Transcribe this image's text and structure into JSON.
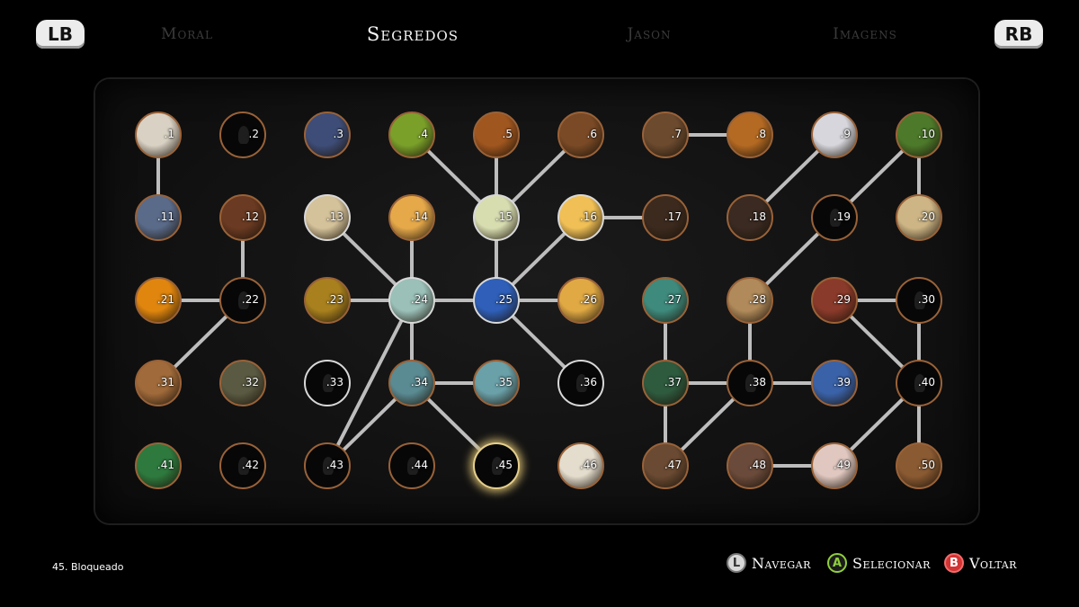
{
  "header": {
    "lb_label": "LB",
    "rb_label": "RB",
    "tabs": [
      {
        "label": "Moral",
        "active": false
      },
      {
        "label": "Segredos",
        "active": true
      },
      {
        "label": "Jason",
        "active": false
      },
      {
        "label": "Imagens",
        "active": false
      }
    ]
  },
  "board": {
    "selected": 45,
    "nodes": [
      {
        "id": 1,
        "label": ".1",
        "state": "photo",
        "color": "#d9d2c4"
      },
      {
        "id": 2,
        "label": ".2",
        "state": "locked"
      },
      {
        "id": 3,
        "label": ".3",
        "state": "photo",
        "color": "#3e4d78"
      },
      {
        "id": 4,
        "label": ".4",
        "state": "photo",
        "color": "#7aa02a"
      },
      {
        "id": 5,
        "label": ".5",
        "state": "photo",
        "color": "#a0561f"
      },
      {
        "id": 6,
        "label": ".6",
        "state": "photo",
        "color": "#7a4a26"
      },
      {
        "id": 7,
        "label": ".7",
        "state": "photo",
        "color": "#6b4a2e"
      },
      {
        "id": 8,
        "label": ".8",
        "state": "photo",
        "color": "#b56a23"
      },
      {
        "id": 9,
        "label": ".9",
        "state": "photo",
        "color": "#d6d6dc"
      },
      {
        "id": 10,
        "label": ".10",
        "state": "photo",
        "color": "#4d7a2a"
      },
      {
        "id": 11,
        "label": ".11",
        "state": "photo",
        "color": "#5a6b8a"
      },
      {
        "id": 12,
        "label": ".12",
        "state": "photo",
        "color": "#6a3a22"
      },
      {
        "id": 13,
        "label": ".13",
        "state": "photo",
        "color": "#d4c29a",
        "ring": "white"
      },
      {
        "id": 14,
        "label": ".14",
        "state": "photo",
        "color": "#e6a94a"
      },
      {
        "id": 15,
        "label": ".15",
        "state": "photo",
        "color": "#d8ddb0",
        "ring": "white"
      },
      {
        "id": 16,
        "label": ".16",
        "state": "photo",
        "color": "#f0c056",
        "ring": "white"
      },
      {
        "id": 17,
        "label": ".17",
        "state": "photo",
        "color": "#3c2a1e"
      },
      {
        "id": 18,
        "label": ".18",
        "state": "photo",
        "color": "#3a2a22"
      },
      {
        "id": 19,
        "label": ".19",
        "state": "locked"
      },
      {
        "id": 20,
        "label": ".20",
        "state": "photo",
        "color": "#cdb585"
      },
      {
        "id": 21,
        "label": ".21",
        "state": "photo",
        "color": "#e0860f"
      },
      {
        "id": 22,
        "label": ".22",
        "state": "locked"
      },
      {
        "id": 23,
        "label": ".23",
        "state": "photo",
        "color": "#a8801e"
      },
      {
        "id": 24,
        "label": ".24",
        "state": "photo",
        "color": "#9ac0b8",
        "ring": "white"
      },
      {
        "id": 25,
        "label": ".25",
        "state": "photo",
        "color": "#2f5fb8",
        "ring": "white"
      },
      {
        "id": 26,
        "label": ".26",
        "state": "photo",
        "color": "#e0a944"
      },
      {
        "id": 27,
        "label": ".27",
        "state": "photo",
        "color": "#3e8a7c"
      },
      {
        "id": 28,
        "label": ".28",
        "state": "photo",
        "color": "#b08a5a"
      },
      {
        "id": 29,
        "label": ".29",
        "state": "photo",
        "color": "#8a3a2a"
      },
      {
        "id": 30,
        "label": ".30",
        "state": "locked"
      },
      {
        "id": 31,
        "label": ".31",
        "state": "photo",
        "color": "#a06a3a"
      },
      {
        "id": 32,
        "label": ".32",
        "state": "photo",
        "color": "#5a5a42"
      },
      {
        "id": 33,
        "label": ".33",
        "state": "locked",
        "ring": "white"
      },
      {
        "id": 34,
        "label": ".34",
        "state": "photo",
        "color": "#5a8a92"
      },
      {
        "id": 35,
        "label": ".35",
        "state": "photo",
        "color": "#6aa0a8"
      },
      {
        "id": 36,
        "label": ".36",
        "state": "locked",
        "ring": "white"
      },
      {
        "id": 37,
        "label": ".37",
        "state": "photo",
        "color": "#2e5a3e"
      },
      {
        "id": 38,
        "label": ".38",
        "state": "locked"
      },
      {
        "id": 39,
        "label": ".39",
        "state": "photo",
        "color": "#3a62a8"
      },
      {
        "id": 40,
        "label": ".40",
        "state": "locked"
      },
      {
        "id": 41,
        "label": ".41",
        "state": "photo",
        "color": "#2e7a3e"
      },
      {
        "id": 42,
        "label": ".42",
        "state": "locked"
      },
      {
        "id": 43,
        "label": ".43",
        "state": "locked"
      },
      {
        "id": 44,
        "label": ".44",
        "state": "locked"
      },
      {
        "id": 45,
        "label": ".45",
        "state": "locked"
      },
      {
        "id": 46,
        "label": ".46",
        "state": "photo",
        "color": "#e4dccc"
      },
      {
        "id": 47,
        "label": ".47",
        "state": "photo",
        "color": "#6a4a32"
      },
      {
        "id": 48,
        "label": ".48",
        "state": "photo",
        "color": "#6a4a3a"
      },
      {
        "id": 49,
        "label": ".49",
        "state": "photo",
        "color": "#e0c8c0"
      },
      {
        "id": 50,
        "label": ".50",
        "state": "photo",
        "color": "#8a5a32"
      }
    ],
    "links": [
      [
        1,
        11
      ],
      [
        7,
        8
      ],
      [
        12,
        22
      ],
      [
        22,
        21
      ],
      [
        22,
        31
      ],
      [
        4,
        15
      ],
      [
        5,
        15
      ],
      [
        6,
        15
      ],
      [
        15,
        25
      ],
      [
        16,
        17
      ],
      [
        16,
        25
      ],
      [
        13,
        24
      ],
      [
        14,
        24
      ],
      [
        23,
        24
      ],
      [
        24,
        25
      ],
      [
        24,
        34
      ],
      [
        24,
        43
      ],
      [
        25,
        26
      ],
      [
        25,
        36
      ],
      [
        34,
        35
      ],
      [
        34,
        45
      ],
      [
        34,
        43
      ],
      [
        9,
        18
      ],
      [
        10,
        19
      ],
      [
        10,
        20
      ],
      [
        19,
        28
      ],
      [
        27,
        37
      ],
      [
        28,
        38
      ],
      [
        29,
        30
      ],
      [
        29,
        40
      ],
      [
        30,
        40
      ],
      [
        37,
        38
      ],
      [
        37,
        47
      ],
      [
        38,
        39
      ],
      [
        38,
        47
      ],
      [
        40,
        50
      ],
      [
        40,
        49
      ],
      [
        48,
        49
      ]
    ]
  },
  "status": {
    "text": "45. Bloqueado"
  },
  "hints": [
    {
      "key": "L",
      "label": "Navegar"
    },
    {
      "key": "A",
      "label": "Selecionar"
    },
    {
      "key": "B",
      "label": "Voltar"
    }
  ]
}
